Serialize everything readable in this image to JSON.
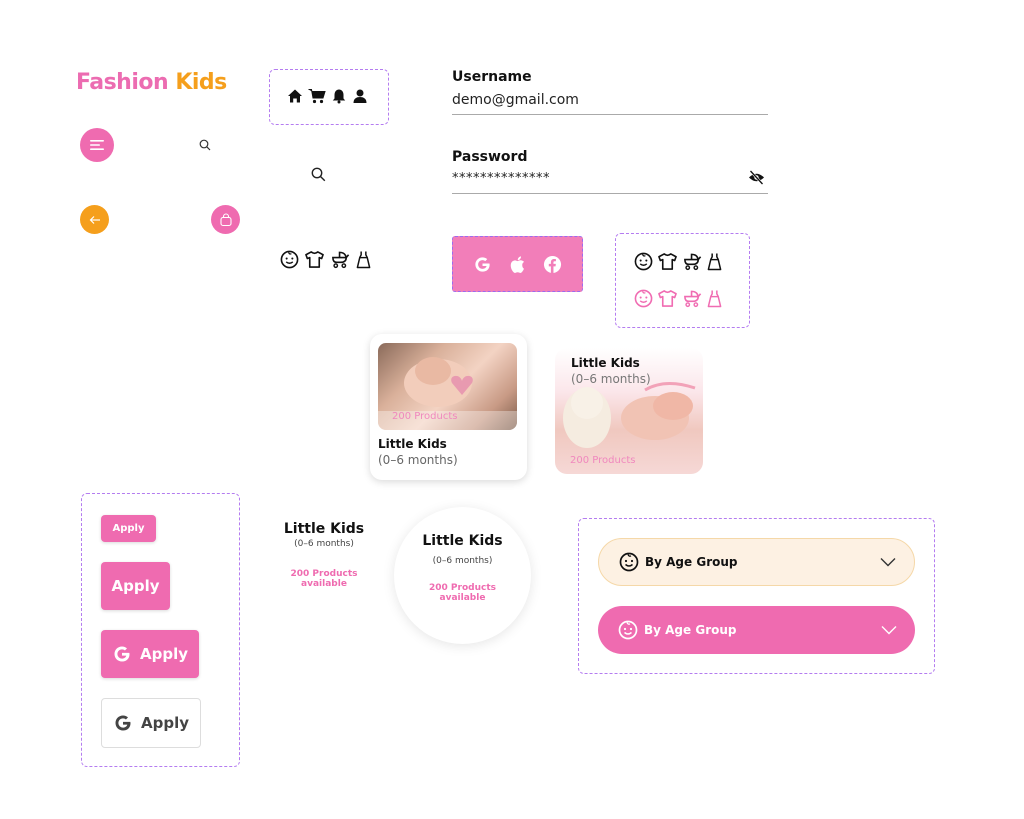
{
  "logo": {
    "part1": "Fashion",
    "part2": "Kids"
  },
  "login": {
    "username_label": "Username",
    "username_value": "demo@gmail.com",
    "password_label": "Password",
    "password_value": "**************"
  },
  "card1": {
    "badge": "200 Products",
    "title": "Little Kids",
    "subtitle": "(0–6 months)"
  },
  "card2": {
    "title": "Little Kids",
    "subtitle": "(0–6 months)",
    "badge": "200 Products"
  },
  "info_plain": {
    "title": "Little Kids",
    "subtitle": "(0–6 months)",
    "products_line1": "200 Products",
    "products_line2": "available"
  },
  "info_circle": {
    "title": "Little Kids",
    "subtitle": "(0–6 months)",
    "products_line1": "200 Products",
    "products_line2": "available"
  },
  "apply_buttons": {
    "small": "Apply",
    "medium": "Apply",
    "google_pink": "Apply",
    "google_white": "Apply"
  },
  "dropdowns": {
    "light": "By Age Group",
    "pink": "By Age Group"
  },
  "colors": {
    "pink": "#ef6bb0",
    "orange": "#f59f1c",
    "dashed_border": "#b47cf0",
    "cream": "#fdf1e3"
  },
  "icons": [
    "menu-icon",
    "search-icon",
    "back-arrow-icon",
    "bag-icon",
    "home-icon",
    "cart-icon",
    "bell-icon",
    "user-icon",
    "google-icon",
    "apple-icon",
    "facebook-icon",
    "baby-face-icon",
    "tshirt-icon",
    "stroller-icon",
    "dress-icon",
    "eye-off-icon",
    "chevron-down-icon"
  ]
}
